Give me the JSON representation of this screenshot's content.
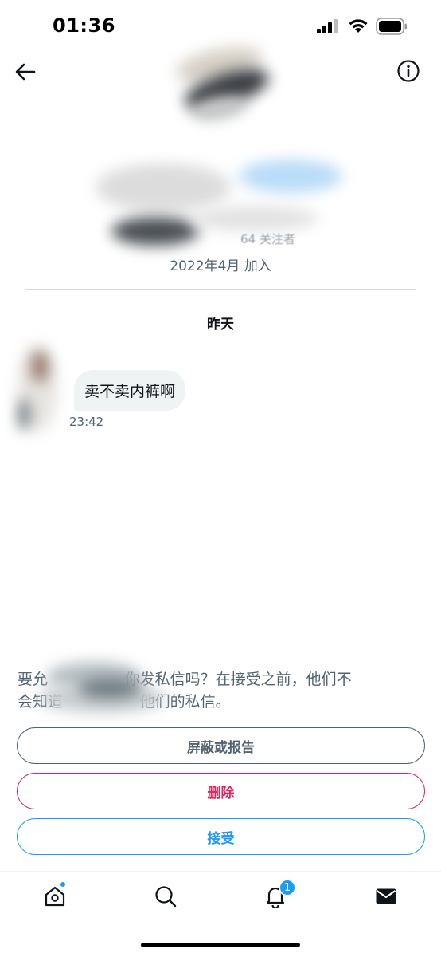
{
  "status_bar": {
    "time": "01:36"
  },
  "header": {
    "back_icon": "arrow-left-icon",
    "info_icon": "info-circle-icon"
  },
  "profile": {
    "follow_stats": "64 关注者",
    "joined": "2022年4月 加入"
  },
  "conversation": {
    "date_header": "昨天",
    "messages": [
      {
        "text": "卖不卖内裤啊",
        "time": "23:42"
      }
    ]
  },
  "request": {
    "text_line1": "要允                你发私信吗？在接受之前，他们不",
    "text_line2": "会知道                他们的私信。",
    "block_report_label": "屏蔽或报告",
    "delete_label": "删除",
    "accept_label": "接受"
  },
  "tabbar": {
    "home_icon": "home-icon",
    "search_icon": "search-icon",
    "notifications_icon": "bell-icon",
    "notifications_badge": "1",
    "messages_icon": "envelope-icon"
  },
  "colors": {
    "accent": "#1d9bf0",
    "danger": "#e0245e",
    "muted": "#536471",
    "bubble": "#eff3f4"
  }
}
